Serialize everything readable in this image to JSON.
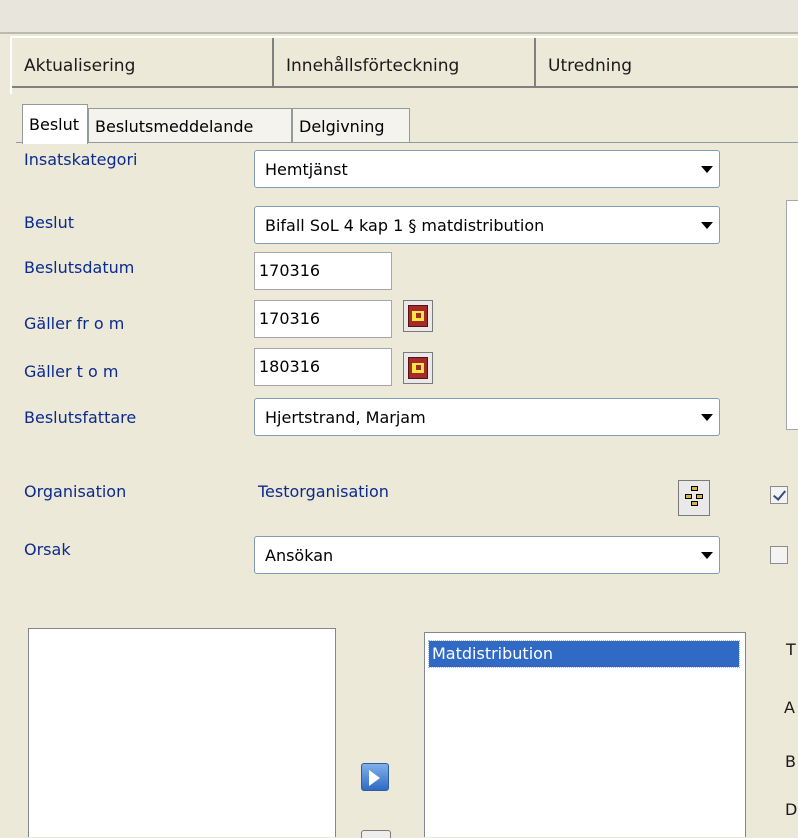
{
  "main_tabs": [
    "Aktualisering",
    "Innehållsförteckning",
    "Utredning"
  ],
  "sub_tabs": [
    "Beslut",
    "Beslutsmeddelande",
    "Delgivning"
  ],
  "form": {
    "insatskategori": {
      "label": "Insatskategori",
      "value": "Hemtjänst"
    },
    "beslut": {
      "label": "Beslut",
      "value": "Bifall SoL 4 kap 1 § matdistribution"
    },
    "beslutsdatum": {
      "label": "Beslutsdatum",
      "value": "170316"
    },
    "galler_from": {
      "label": "Gäller fr o m",
      "value": "170316"
    },
    "galler_tom": {
      "label": "Gäller t o m",
      "value": "180316"
    },
    "beslutsfattare": {
      "label": "Beslutsfattare",
      "value": "Hjertstrand, Marjam"
    },
    "organisation": {
      "label": "Organisation",
      "value": "Testorganisation"
    },
    "orsak": {
      "label": "Orsak",
      "value": "Ansökan"
    }
  },
  "selected_list": [
    "Matdistribution"
  ],
  "right_cutoff_letters": [
    "T",
    "A",
    "B",
    "D"
  ],
  "checkboxes": {
    "first_checked": true,
    "second_checked": false
  },
  "colors": {
    "label": "#0B2A8C",
    "selection": "#316AC5",
    "background": "#ECE9D8"
  }
}
